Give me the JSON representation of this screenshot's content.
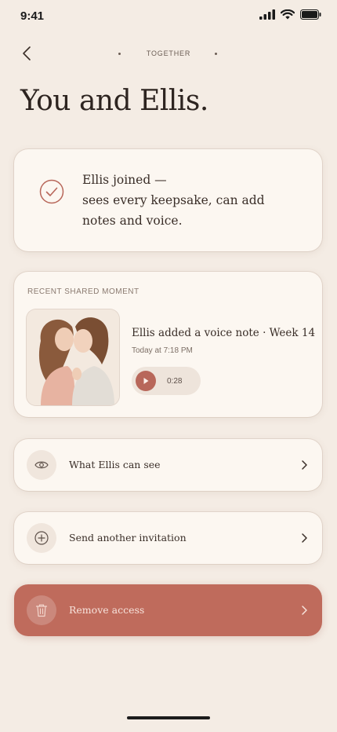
{
  "status": {
    "time": "9:41"
  },
  "nav": {
    "title": "TOGETHER"
  },
  "page": {
    "title": "You and Ellis."
  },
  "joined": {
    "line1": "Ellis joined —",
    "line2": "sees every keepsake, can add",
    "line3": "notes and voice."
  },
  "moment": {
    "label": "RECENT SHARED MOMENT",
    "title": "Ellis added a voice note · Week 14",
    "time": "Today at 7:18 PM",
    "duration": "0:28"
  },
  "rows": {
    "see": "What Ellis can see",
    "invite": "Send another invitation",
    "remove": "Remove access"
  },
  "colors": {
    "accent": "#bf6b5c",
    "background": "#f4ece4",
    "card": "#fcf7f1"
  },
  "icons": {
    "back": "chevron-left-icon",
    "check": "check-circle-icon",
    "play": "play-icon",
    "eye": "eye-icon",
    "plus": "plus-circle-icon",
    "trash": "trash-icon",
    "chevron": "chevron-right-icon"
  }
}
